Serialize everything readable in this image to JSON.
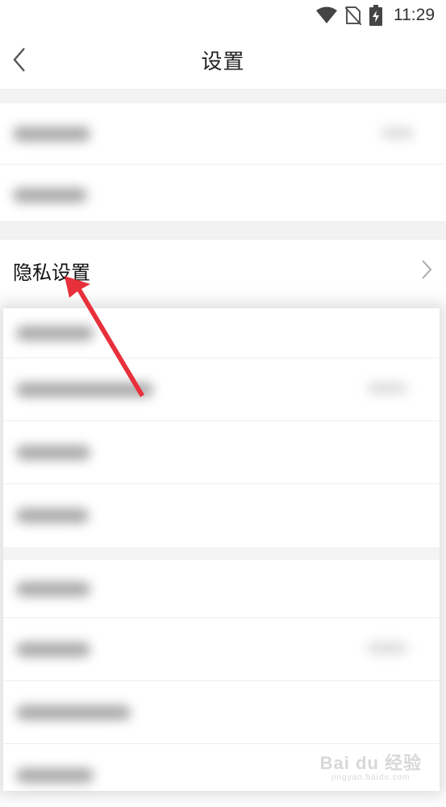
{
  "status_bar": {
    "time": "11:29",
    "icons": [
      "wifi-icon",
      "no-sim-icon",
      "battery-charging-icon"
    ]
  },
  "nav": {
    "title": "设置",
    "back_icon": "chevron-left-icon"
  },
  "privacy_row": {
    "label": "隐私设置",
    "icon": "chevron-right-icon"
  },
  "watermark": {
    "main": "Bai du 经验",
    "sub": "jingyan.baidu.com"
  },
  "colors": {
    "annotation_arrow": "#e8303a",
    "section_gap": "#f2f2f2"
  }
}
